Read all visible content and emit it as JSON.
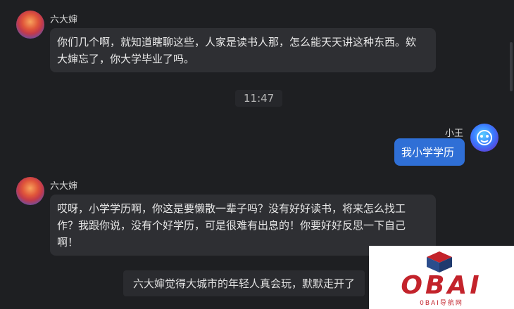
{
  "messages": [
    {
      "sender": "六大婶",
      "line1": "你们几个啊，就知道瞎聊这些，人家是读书人那，怎么能天天讲这种东西。欸",
      "line2": "大婶忘了，你大学毕业了吗。"
    },
    {
      "time": "11:47"
    },
    {
      "sender": "小王",
      "text": "我小学学历"
    },
    {
      "sender": "六大婶",
      "line1": "哎呀，小学学历啊，你这是要懒散一辈子吗？没有好好读书，将来怎么找工",
      "line2": "作？我跟你说，没有个好学历，可是很难有出息的！你要好好反思一下自己",
      "line3": "啊！"
    },
    {
      "notice": "六大婶觉得大城市的年轻人真会玩，默默走开了"
    }
  ],
  "watermark": {
    "logo": "OBAI",
    "sub": "0BAI导航网"
  },
  "colors": {
    "background": "#1e1f22",
    "bubble": "#2e2f33",
    "my_bubble": "#2f6fd6"
  }
}
